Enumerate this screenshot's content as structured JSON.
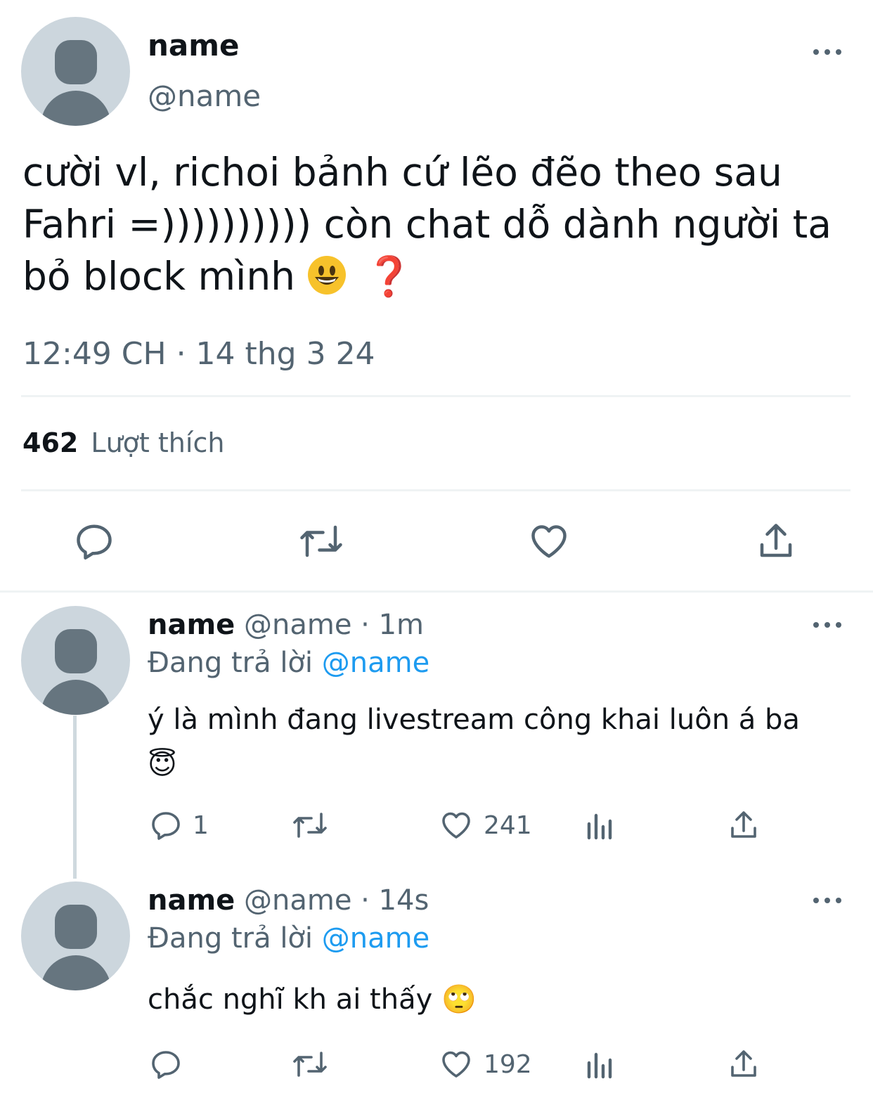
{
  "main_tweet": {
    "display_name": "name",
    "handle": "@name",
    "text_line1": "cười vl, richoi bảnh cứ lẽo đẽo theo sau",
    "text_line2": "Fahri =)))))))))) còn chat dỗ dành người ta",
    "text_line3": "bỏ block mình",
    "emoji_after_text": "smiling-face-emoji",
    "emoji_question": "❓",
    "timestamp": "12:49 CH · 14 thg 3 24",
    "likes_count": "462",
    "likes_label": "Lượt thích"
  },
  "replies": [
    {
      "display_name": "name",
      "handle": "@name",
      "time": "· 1m",
      "replying_label": "Đang trả lời",
      "replying_to": "@name",
      "text": "ý là mình đang livestream công khai luôn á ba",
      "emoji": "😇",
      "reply_count": "1",
      "retweet_count": "",
      "like_count": "241"
    },
    {
      "display_name": "name",
      "handle": "@name",
      "time": "· 14s",
      "replying_label": "Đang trả lời",
      "replying_to": "@name",
      "text": "chắc nghĩ kh ai thấy",
      "emoji": "🙄",
      "reply_count": "",
      "retweet_count": "",
      "like_count": "192"
    }
  ],
  "colors": {
    "text_primary": "#0f1419",
    "text_secondary": "#536471",
    "link_blue": "#1d9bf0",
    "divider": "#eff3f4",
    "avatar_bg": "#ccd6dd",
    "avatar_fg": "#66757f"
  }
}
